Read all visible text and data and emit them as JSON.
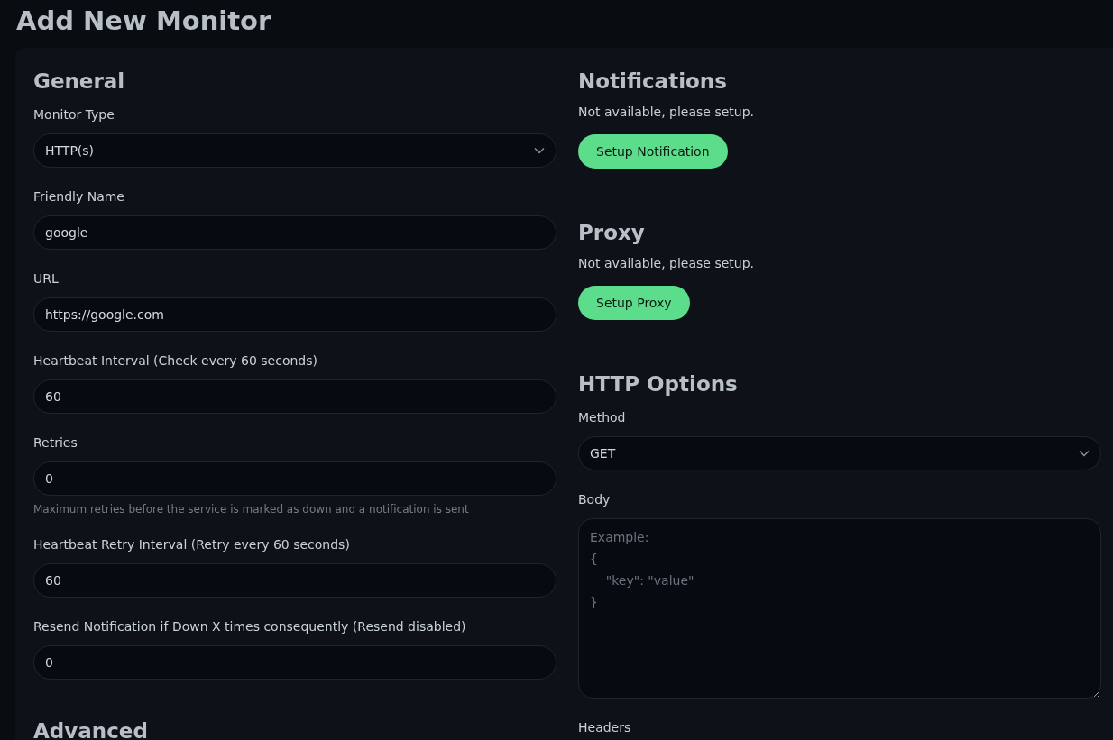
{
  "title": "Add New Monitor",
  "general": {
    "heading": "General",
    "fields": [
      {
        "kind": "select",
        "label": "Monitor Type",
        "value": "HTTP(s)"
      },
      {
        "kind": "input",
        "label": "Friendly Name",
        "value": "google"
      },
      {
        "kind": "input",
        "label": "URL",
        "value": "https://google.com"
      },
      {
        "kind": "input",
        "label": "Heartbeat Interval (Check every 60 seconds)",
        "value": "60"
      },
      {
        "kind": "input",
        "label": "Retries",
        "value": "0",
        "help": "Maximum retries before the service is marked as down and a notification is sent"
      },
      {
        "kind": "input",
        "label": "Heartbeat Retry Interval (Retry every 60 seconds)",
        "value": "60"
      },
      {
        "kind": "input",
        "label": "Resend Notification if Down X times consequently (Resend disabled)",
        "value": "0"
      }
    ]
  },
  "advanced": {
    "heading": "Advanced"
  },
  "notifications": {
    "heading": "Notifications",
    "message": "Not available, please setup.",
    "button": "Setup Notification"
  },
  "proxy": {
    "heading": "Proxy",
    "message": "Not available, please setup.",
    "button": "Setup Proxy"
  },
  "http_options": {
    "heading": "HTTP Options",
    "fields": [
      {
        "kind": "select",
        "label": "Method",
        "value": "GET"
      },
      {
        "kind": "textarea",
        "label": "Body",
        "placeholder": "Example:\n{\n    \"key\": \"value\"\n}"
      },
      {
        "kind": "label",
        "label": "Headers"
      }
    ]
  }
}
